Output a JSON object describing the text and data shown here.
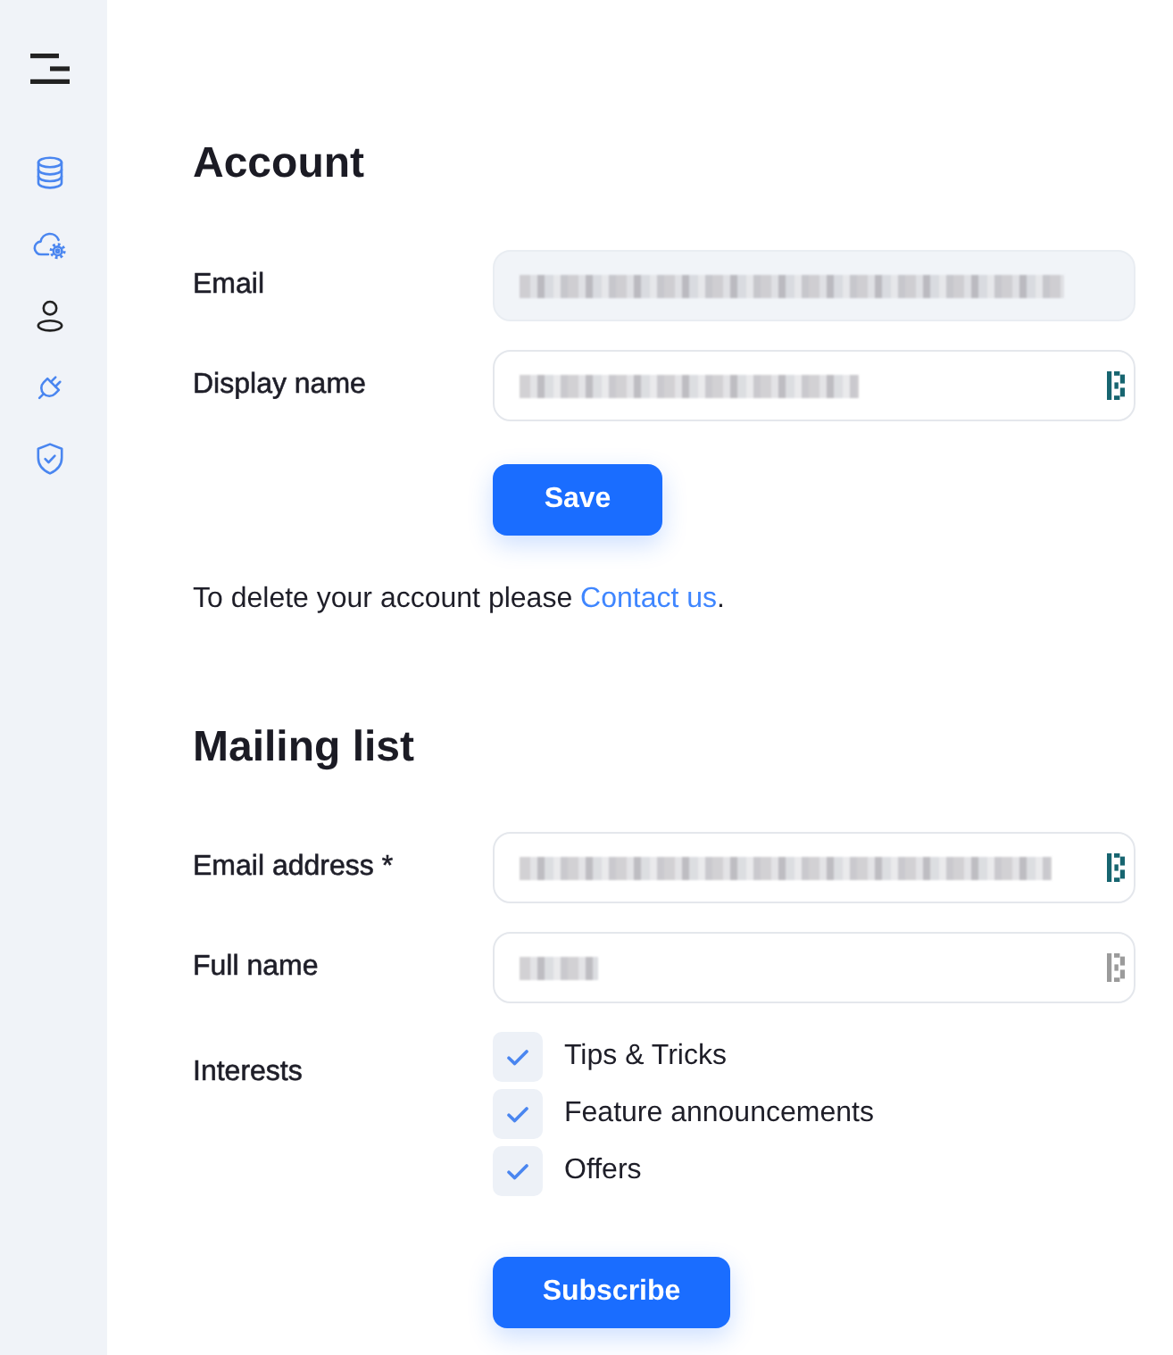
{
  "sidebar": {
    "items": [
      {
        "kind": "database",
        "selected": false
      },
      {
        "kind": "cloud-settings",
        "selected": false
      },
      {
        "kind": "user",
        "selected": true
      },
      {
        "kind": "plug",
        "selected": false
      },
      {
        "kind": "shield",
        "selected": false
      }
    ]
  },
  "account": {
    "title": "Account",
    "fields": [
      {
        "label": "Email",
        "disabled": true,
        "blurred": true,
        "autofill_icon": false
      },
      {
        "label": "Display name",
        "disabled": false,
        "blurred": true,
        "autofill_icon": true,
        "autofill_active": true
      }
    ],
    "save_button": "Save",
    "delete_note": {
      "text": "To delete your account please ",
      "link": "Contact us",
      "after": "."
    }
  },
  "mailing_list": {
    "title": "Mailing list",
    "fields": [
      {
        "label": "Email address *",
        "disabled": false,
        "blurred": true,
        "autofill_icon": true,
        "autofill_active": true
      },
      {
        "label": "Full name",
        "disabled": false,
        "blurred": true,
        "autofill_icon": true,
        "autofill_active": false
      }
    ],
    "interests": {
      "label": "Interests",
      "options": [
        {
          "label": "Tips & Tricks",
          "checked": true
        },
        {
          "label": "Feature announcements",
          "checked": true
        },
        {
          "label": "Offers",
          "checked": true
        }
      ]
    },
    "subscribe_button": "Subscribe"
  }
}
